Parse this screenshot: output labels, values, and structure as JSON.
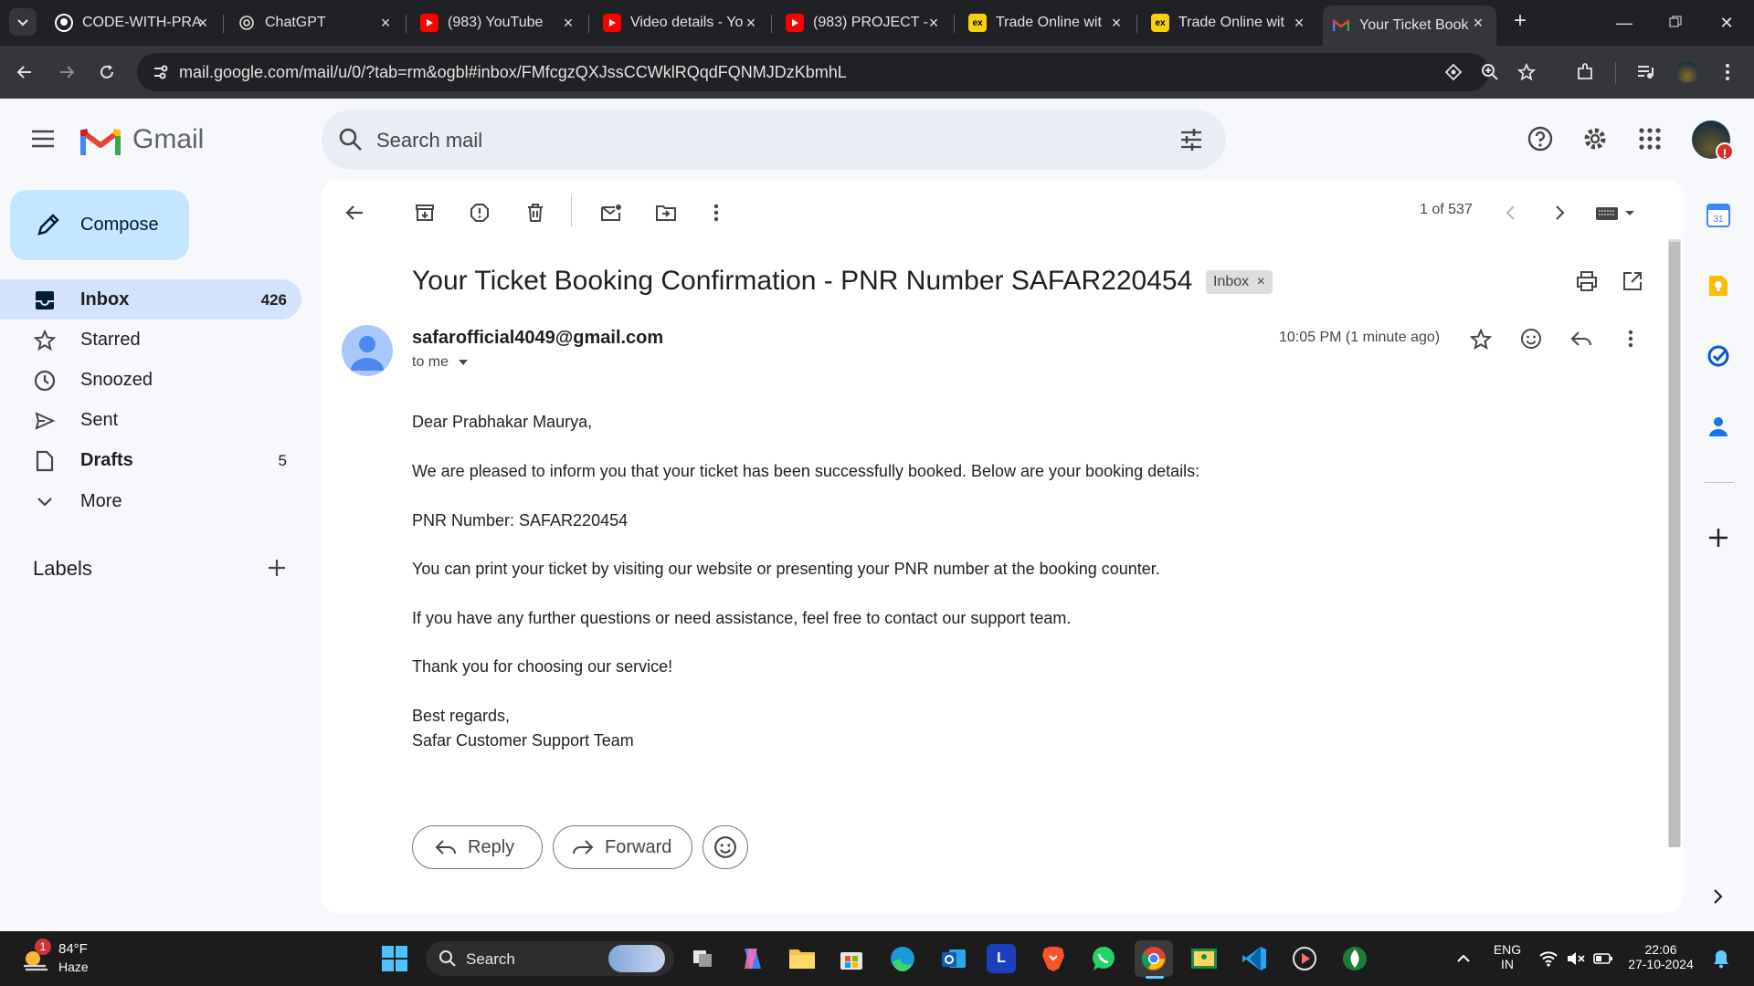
{
  "browser": {
    "tabs": [
      {
        "title": "CODE-WITH-PRA",
        "favicon": "github-icon"
      },
      {
        "title": "ChatGPT",
        "favicon": "chatgpt-icon"
      },
      {
        "title": "(983) YouTube",
        "favicon": "youtube-icon"
      },
      {
        "title": "Video details - Yo",
        "favicon": "youtube-icon"
      },
      {
        "title": "(983) PROJECT -",
        "favicon": "youtube-icon"
      },
      {
        "title": "Trade Online wit",
        "favicon": "ex-icon"
      },
      {
        "title": "Trade Online wit",
        "favicon": "ex-icon"
      },
      {
        "title": "Your Ticket Book",
        "favicon": "gmail-icon",
        "active": true
      }
    ],
    "url": "mail.google.com/mail/u/0/?tab=rm&ogbl#inbox/FMfcgzQXJssCCWklRQqdFQNMJDzKbmhL"
  },
  "gmail": {
    "product_name": "Gmail",
    "search_placeholder": "Search mail",
    "compose_label": "Compose",
    "nav": [
      {
        "label": "Inbox",
        "count": "426",
        "bold": true,
        "active": true,
        "icon": "inbox-icon"
      },
      {
        "label": "Starred",
        "count": "",
        "icon": "star-icon"
      },
      {
        "label": "Snoozed",
        "count": "",
        "icon": "clock-icon"
      },
      {
        "label": "Sent",
        "count": "",
        "icon": "send-icon"
      },
      {
        "label": "Drafts",
        "count": "5",
        "bold": true,
        "icon": "draft-icon"
      },
      {
        "label": "More",
        "count": "",
        "icon": "chevron-down-icon"
      }
    ],
    "labels_title": "Labels",
    "pager": "1 of 537",
    "subject": "Your Ticket Booking Confirmation - PNR Number SAFAR220454",
    "inbox_chip": "Inbox",
    "sender": "safarofficial4049@gmail.com",
    "recipient": "to me",
    "time": "10:05 PM (1 minute ago)",
    "body": [
      "Dear Prabhakar Maurya,",
      "We are pleased to inform you that your ticket has been successfully booked. Below are your booking details:",
      "PNR Number: SAFAR220454",
      "You can print your ticket by visiting our website or presenting your PNR number at the booking counter.",
      "If you have any further questions or need assistance, feel free to contact our support team.",
      "Thank you for choosing our service!",
      "Best regards,",
      "Safar Customer Support Team"
    ],
    "reply_label": "Reply",
    "forward_label": "Forward",
    "colors": {
      "accent": "#0b57d0",
      "compose_bg": "#c2e7ff",
      "active_nav_bg": "#d3e3fd"
    }
  },
  "taskbar": {
    "weather_temp": "84°F",
    "weather_desc": "Haze",
    "weather_badge": "1",
    "search_label": "Search",
    "language": "ENG",
    "region": "IN",
    "time": "22:06",
    "date": "27-10-2024",
    "calendar_day": "31"
  }
}
